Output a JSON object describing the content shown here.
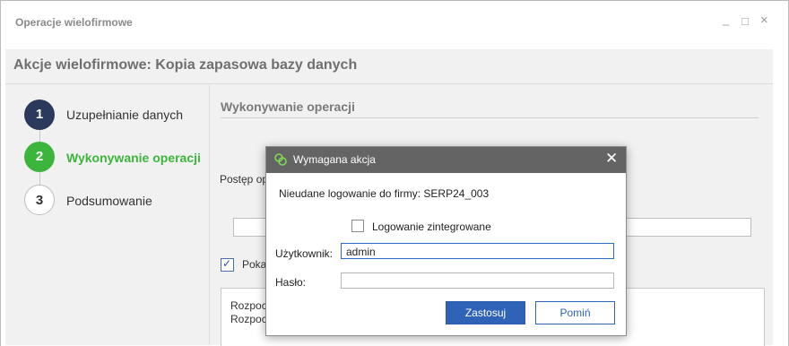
{
  "window": {
    "title": "Operacje wielofirmowe",
    "controls": {
      "minimize": "_",
      "maximize": "□",
      "close": "×"
    }
  },
  "header": {
    "title": "Akcje wielofirmowe: Kopia zapasowa bazy danych"
  },
  "steps": [
    {
      "number": "1",
      "label": "Uzupełnianie danych",
      "state": "completed",
      "color": "#2b3a5c"
    },
    {
      "number": "2",
      "label": "Wykonywanie operacji",
      "state": "active",
      "color": "#3cb53c"
    },
    {
      "number": "3",
      "label": "Podsumowanie",
      "state": "pending",
      "color": "#ffffff"
    }
  ],
  "main": {
    "section_title": "Wykonywanie operacji",
    "progress_label": "Postęp op",
    "show_label": "Poka",
    "show_checked": true,
    "log_lines": [
      "Rozpoc",
      "Rozpoc"
    ]
  },
  "dialog": {
    "title": "Wymagana akcja",
    "icon": "link-icon",
    "message": "Nieudane logowanie do firmy: SERP24_003",
    "integrated_label": "Logowanie zintegrowane",
    "integrated_checked": false,
    "user_label": "Użytkownik:",
    "user_value": "admin",
    "password_label": "Hasło:",
    "password_value": "",
    "apply_label": "Zastosuj",
    "skip_label": "Pomiń",
    "accent_color": "#2f63b8"
  }
}
